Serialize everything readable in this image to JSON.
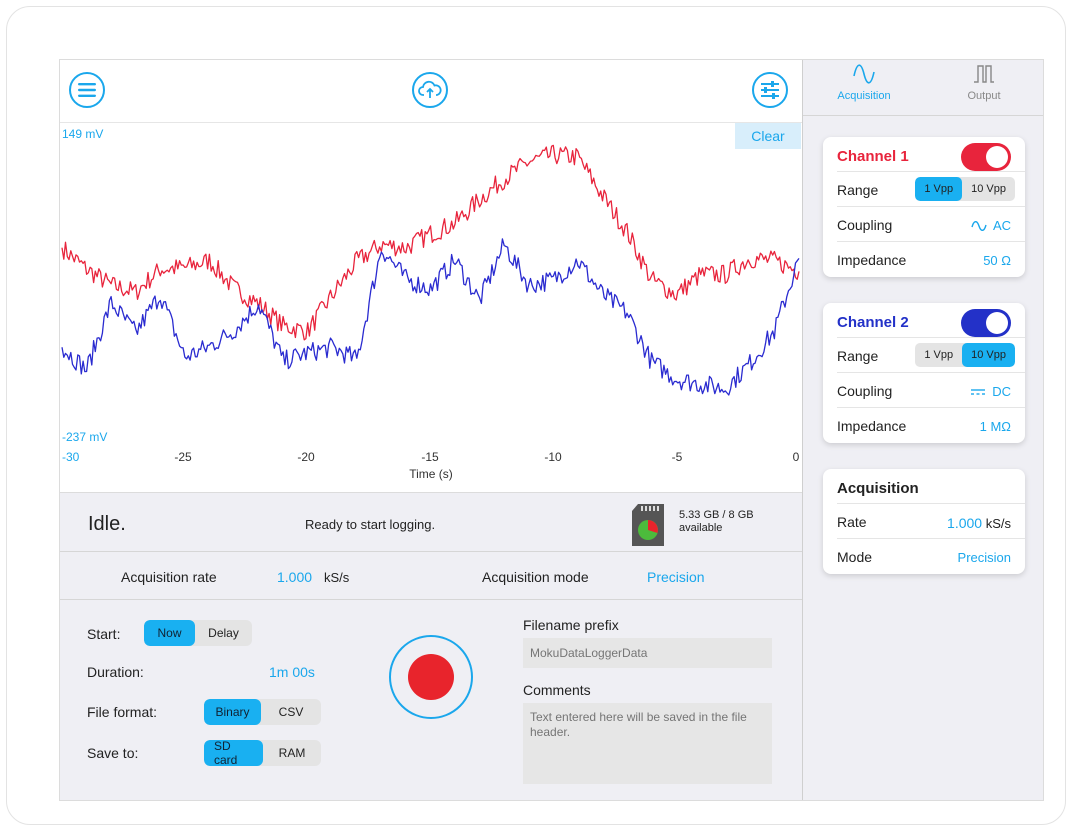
{
  "toolbar": {
    "menu_icon": "menu-icon",
    "upload_icon": "cloud-upload-icon",
    "settings_icon": "sliders-icon"
  },
  "plot": {
    "clear_label": "Clear",
    "y_top_label": "149 mV",
    "y_bottom_label": "-237 mV",
    "x_ticks": [
      "-30",
      "-25",
      "-20",
      "-15",
      "-10",
      "-5",
      "0"
    ],
    "x_axis_label": "Time (s)"
  },
  "chart_data": {
    "type": "line",
    "xlabel": "Time (s)",
    "ylabel": "",
    "xlim": [
      -30,
      0
    ],
    "ylim": [
      -237,
      149
    ],
    "series": [
      {
        "color": "#e8243c",
        "x": [
          -30,
          -29,
          -28,
          -27,
          -26,
          -25,
          -24,
          -23,
          -22,
          -21,
          -20,
          -19,
          -18,
          -17,
          -16,
          -15,
          -14,
          -13,
          -12,
          -11,
          -10,
          -9,
          -8,
          -7,
          -6,
          -5,
          -4,
          -3,
          -2,
          -1,
          0
        ],
        "values": [
          6,
          -22,
          -43,
          -52,
          -22,
          -20,
          -11,
          -47,
          -67,
          -96,
          -103,
          -56,
          -12,
          10,
          6,
          24,
          38,
          69,
          96,
          118,
          127,
          124,
          74,
          27,
          -36,
          -55,
          -29,
          -29,
          -8,
          -11,
          -25
        ]
      },
      {
        "color": "#2a2bd0",
        "x": [
          -30,
          -29,
          -28,
          -27,
          -26,
          -25,
          -24,
          -23,
          -22,
          -21,
          -20,
          -19,
          -18,
          -17,
          -16,
          -15,
          -14,
          -13,
          -12,
          -11,
          -10,
          -9,
          -8,
          -7,
          -6,
          -5,
          -4,
          -3,
          -2,
          -1,
          0
        ],
        "values": [
          -124,
          -153,
          -66,
          -105,
          -55,
          -137,
          -123,
          -102,
          -67,
          -142,
          -131,
          -124,
          -140,
          5,
          -35,
          -48,
          -10,
          -63,
          10,
          -43,
          -36,
          -11,
          -55,
          -79,
          -143,
          -165,
          -172,
          -178,
          -145,
          -103,
          -8
        ]
      }
    ]
  },
  "status": {
    "state": "Idle.",
    "message": "Ready to start logging.",
    "storage_line1": "5.33 GB / 8 GB",
    "storage_line2": "available",
    "storage_used_fraction": 0.33
  },
  "acquisition_bar": {
    "rate_label": "Acquisition rate",
    "rate_value": "1.000",
    "rate_unit": "kS/s",
    "mode_label": "Acquisition mode",
    "mode_value": "Precision"
  },
  "form": {
    "start_label": "Start:",
    "start_options": [
      "Now",
      "Delay"
    ],
    "duration_label": "Duration:",
    "duration_value": "1m 00s",
    "format_label": "File format:",
    "format_options": [
      "Binary",
      "CSV"
    ],
    "save_label": "Save to:",
    "save_options": [
      "SD card",
      "RAM"
    ],
    "filename_label": "Filename prefix",
    "filename_placeholder": "MokuDataLoggerData",
    "comments_label": "Comments",
    "comments_placeholder": "Text entered here will be saved in the file header."
  },
  "tabs": {
    "acquisition": "Acquisition",
    "output": "Output"
  },
  "channel1": {
    "title": "Channel 1",
    "color": "#e8243c",
    "range_label": "Range",
    "range_options": [
      "1 Vpp",
      "10 Vpp"
    ],
    "coupling_label": "Coupling",
    "coupling_value": "AC",
    "impedance_label": "Impedance",
    "impedance_value": "50 Ω"
  },
  "channel2": {
    "title": "Channel 2",
    "color": "#2331c8",
    "range_label": "Range",
    "range_options": [
      "1 Vpp",
      "10 Vpp"
    ],
    "coupling_label": "Coupling",
    "coupling_value": "DC",
    "impedance_label": "Impedance",
    "impedance_value": "1 MΩ"
  },
  "acq_card": {
    "title": "Acquisition",
    "rate_label": "Rate",
    "rate_value": "1.000",
    "rate_unit": "kS/s",
    "mode_label": "Mode",
    "mode_value": "Precision"
  }
}
